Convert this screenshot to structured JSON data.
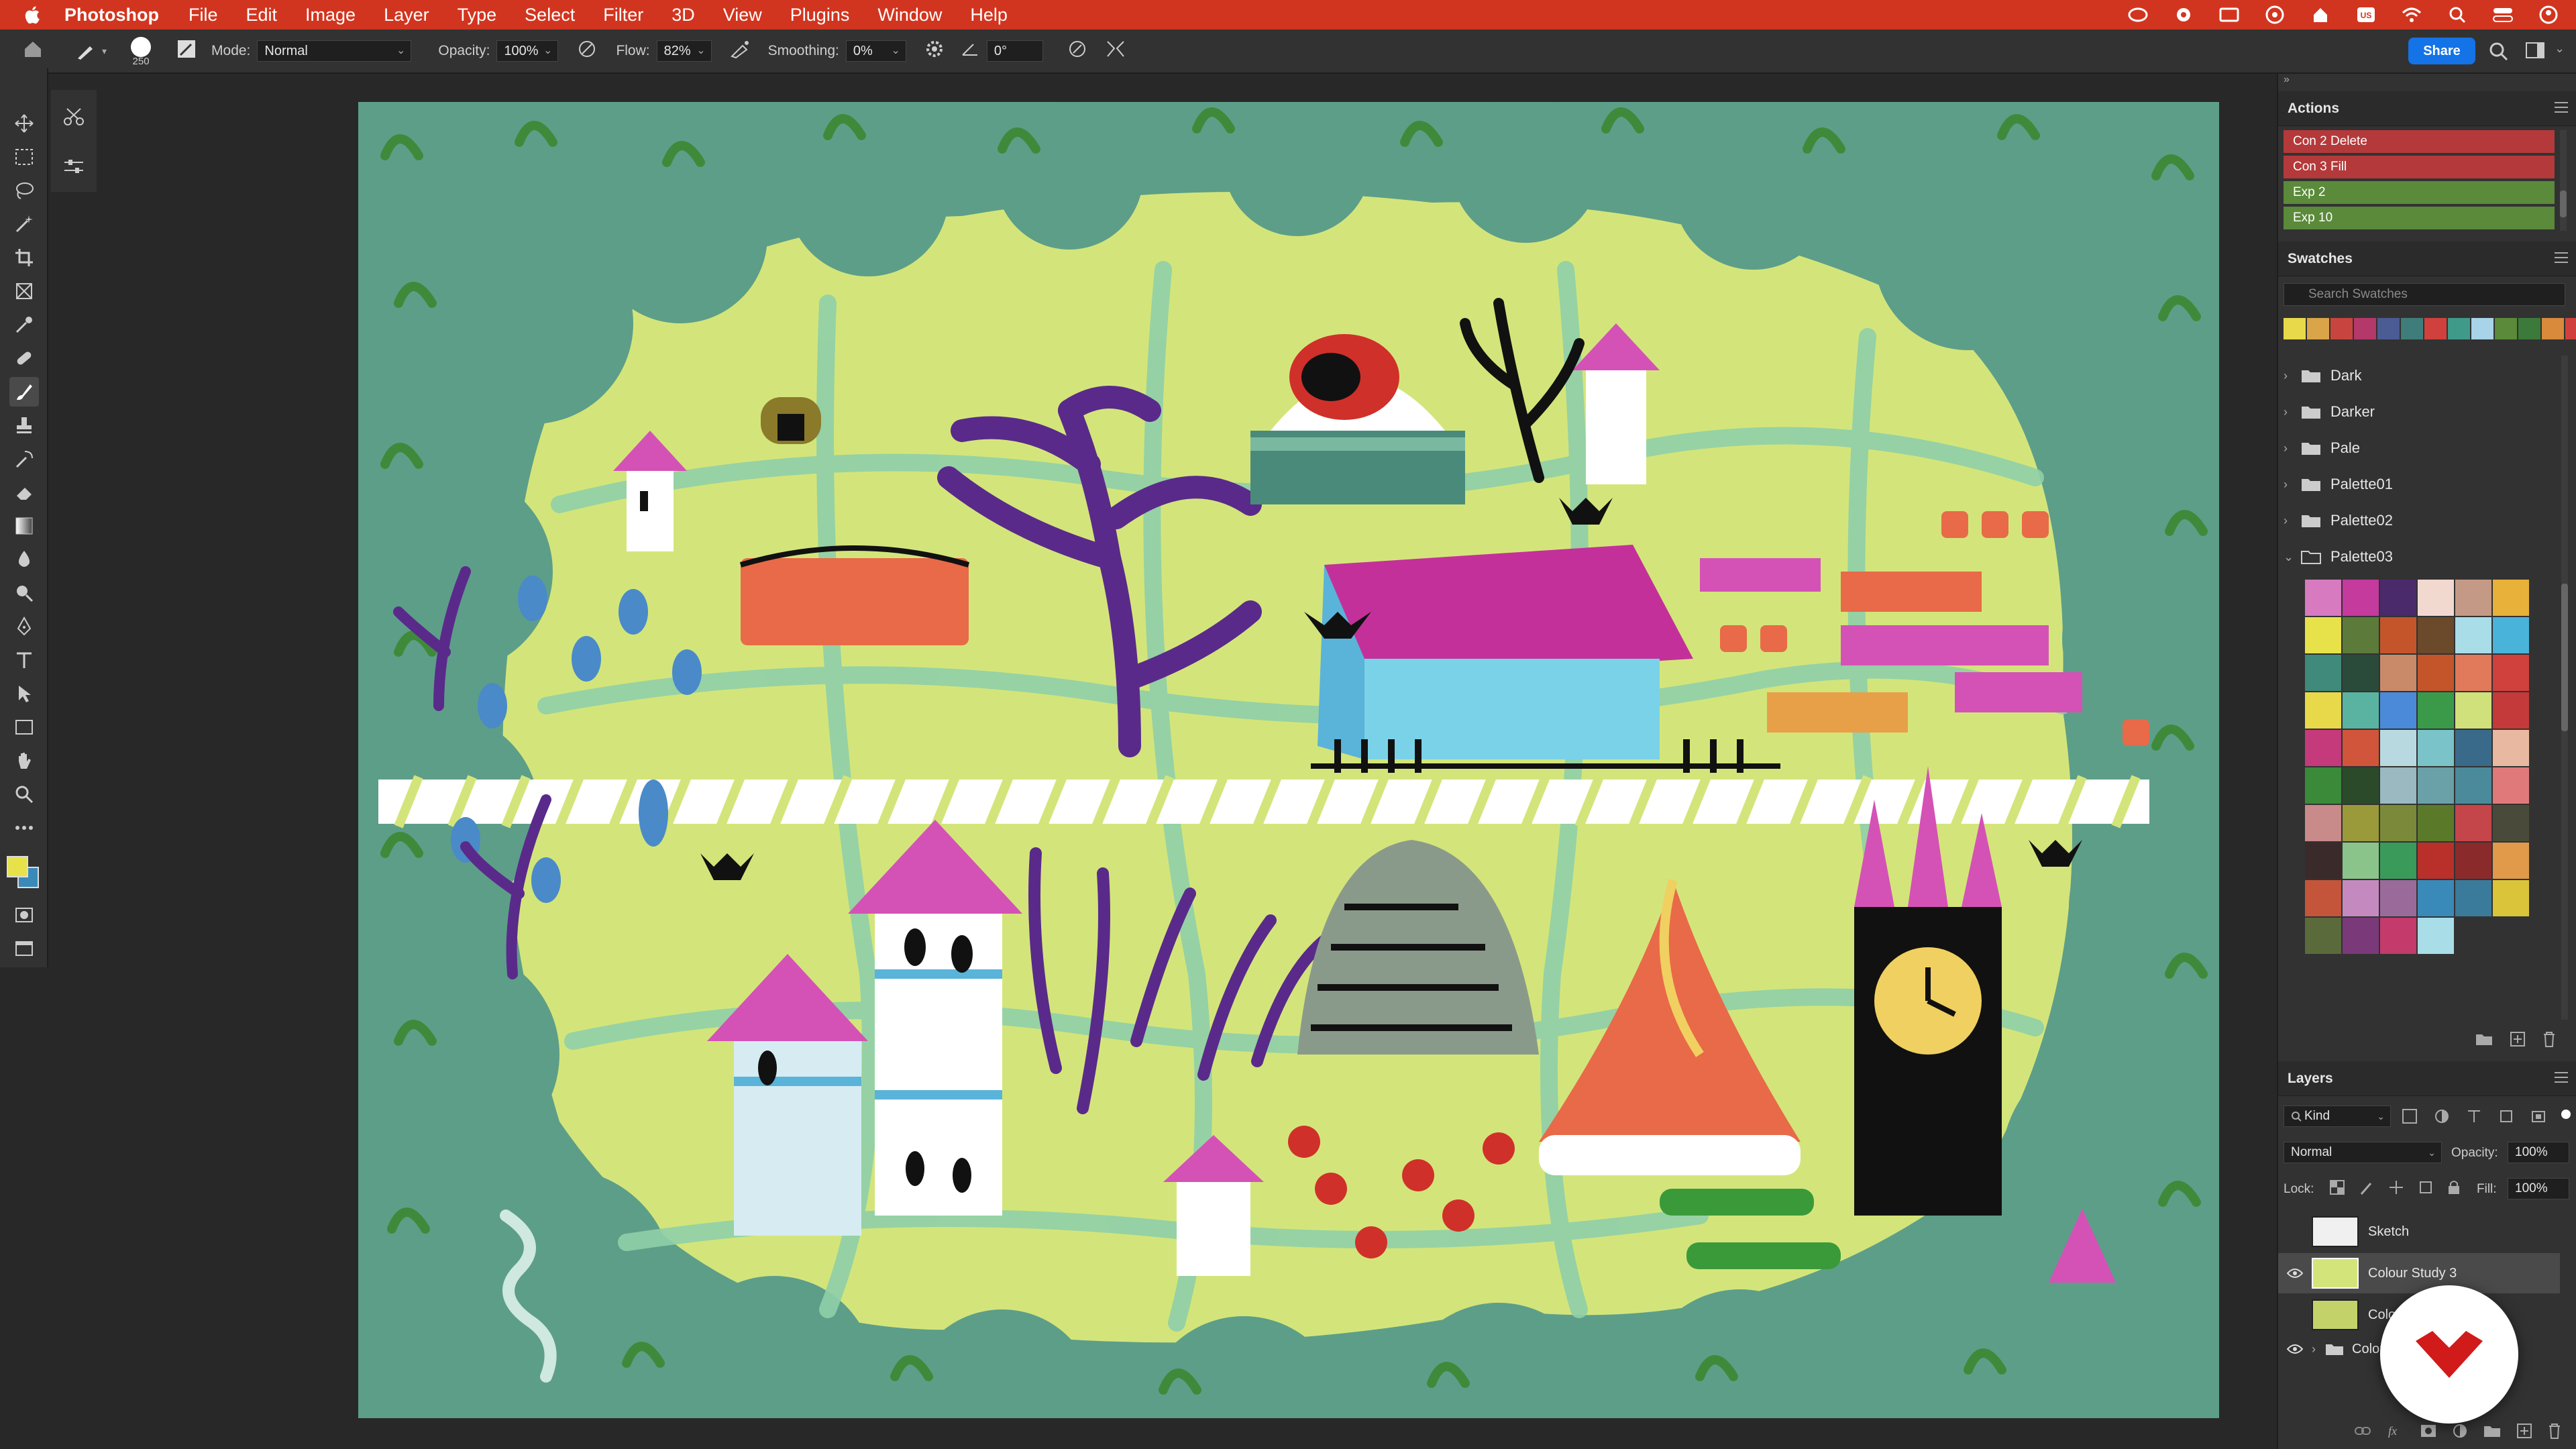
{
  "menubar": {
    "app_name": "Photoshop",
    "items": [
      "File",
      "Edit",
      "Image",
      "Layer",
      "Type",
      "Select",
      "Filter",
      "3D",
      "View",
      "Plugins",
      "Window",
      "Help"
    ]
  },
  "options": {
    "brush_size": "250",
    "mode_label": "Mode:",
    "mode_value": "Normal",
    "opacity_label": "Opacity:",
    "opacity_value": "100%",
    "flow_label": "Flow:",
    "flow_value": "82%",
    "smoothing_label": "Smoothing:",
    "smoothing_value": "0%",
    "angle_value": "0°",
    "share_label": "Share"
  },
  "actions_panel": {
    "title": "Actions",
    "items": [
      {
        "label": "Con 2 Delete",
        "color": "#b4393a"
      },
      {
        "label": "Con 3 Fill",
        "color": "#b4393a"
      },
      {
        "label": "Exp 2",
        "color": "#5a8a3a"
      },
      {
        "label": "Exp 10",
        "color": "#5a8a3a"
      }
    ]
  },
  "swatches_panel": {
    "title": "Swatches",
    "search_placeholder": "Search Swatches",
    "recent": [
      "#e8d94a",
      "#d9a548",
      "#c8453f",
      "#b5386a",
      "#4b5b94",
      "#3f7d7b",
      "#d0403d",
      "#3f9a89",
      "#a9d3e8",
      "#5b8a3a",
      "#3b7a3a",
      "#d98a3a",
      "#d0403d"
    ],
    "folders": [
      "Dark",
      "Darker",
      "Pale",
      "Palette01",
      "Palette02",
      "Palette03"
    ],
    "palette03": [
      "#d77ac0",
      "#c43a9d",
      "#4a2a6a",
      "#f2d9d0",
      "#c49a86",
      "#e8b13a",
      "#e8e24a",
      "#5c7a3a",
      "#c4552a",
      "#6a4a2a",
      "#a9dde8",
      "#4ab3d9",
      "#3f8a7a",
      "#2a4a3a",
      "#c98a6a",
      "#c4552a",
      "#e07a5a",
      "#d0403d",
      "#e8d94a",
      "#5ab3a0",
      "#4b8ad9",
      "#3a9a4a",
      "#d0e07a",
      "#c43a3a",
      "#c43a7a",
      "#d0553a",
      "#b9d9e0",
      "#7ac4c9",
      "#3a6a8a",
      "#e8b9a0",
      "#3a8a3a",
      "#2a4a2a",
      "#9ab9c0",
      "#6aa0a8",
      "#4a8a9a",
      "#e07a7a",
      "#c98a8a",
      "#9a9a3a",
      "#7a8a3a",
      "#5a7a2a",
      "#c4454a",
      "#4a4a3a",
      "#3a2a2a",
      "#8ac48a",
      "#3a9a5a",
      "#b9302a",
      "#8a2a2a",
      "#e09a4a",
      "#c4553a",
      "#c48ac0",
      "#9a6a9a",
      "#3a8ab9",
      "#3a7a9a",
      "#d9c43a",
      "#5a6a3a",
      "#7a3a7a",
      "#c43a6a",
      "#a9dde8"
    ]
  },
  "layers_panel": {
    "title": "Layers",
    "kind_label": "Kind",
    "blend_value": "Normal",
    "opacity_label": "Opacity:",
    "opacity_value": "100%",
    "lock_label": "Lock:",
    "fill_label": "Fill:",
    "fill_value": "100%",
    "layers": [
      {
        "name": "Sketch",
        "visible": false,
        "selected": false
      },
      {
        "name": "Colour Study 3",
        "visible": true,
        "selected": true
      },
      {
        "name": "Colour Study 2",
        "visible": false,
        "selected": false
      },
      {
        "name": "Colou",
        "visible": true,
        "selected": false,
        "group": true
      }
    ]
  },
  "colors": {
    "foreground": "#e8e24a",
    "background": "#3a8ab9",
    "menubar": "#d2351f",
    "accent": "#1473e6"
  },
  "icons": [
    "apple-icon",
    "creative-cloud-icon",
    "wifi-icon",
    "search-icon",
    "control-center-icon",
    "brush-icon",
    "move-icon",
    "marquee-icon",
    "lasso-icon",
    "crop-icon",
    "eyedropper-icon",
    "eraser-icon",
    "type-icon",
    "hand-icon",
    "zoom-icon",
    "eye-icon",
    "folder-icon",
    "trash-icon"
  ]
}
